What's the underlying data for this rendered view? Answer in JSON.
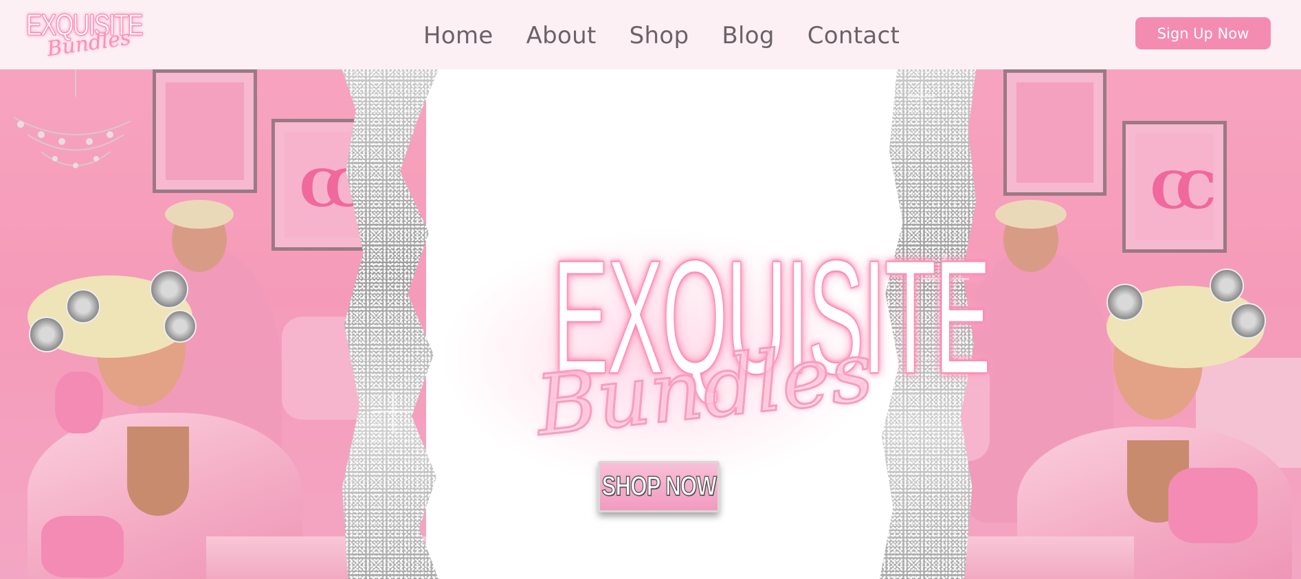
{
  "header": {
    "logo": {
      "main": "EXQUISITE",
      "script": "Bundles"
    },
    "nav": [
      {
        "label": "Home"
      },
      {
        "label": "About"
      },
      {
        "label": "Shop"
      },
      {
        "label": "Blog"
      },
      {
        "label": "Contact"
      }
    ],
    "signup_label": "Sign Up Now"
  },
  "hero": {
    "title": "EXQUISITE",
    "script": "Bundles",
    "cta_label": "SHOP NOW"
  },
  "colors": {
    "header_bg": "#fdf0f4",
    "accent_pink": "#f48cb2",
    "nav_text": "#6b6168",
    "scene_pink": "#f59bb9",
    "glitter_silver": "#c9c9c9"
  },
  "icons": {
    "wall_logo": "cc-logo-icon",
    "chandelier": "chandelier-icon",
    "sparkle": "sparkle-icon"
  }
}
